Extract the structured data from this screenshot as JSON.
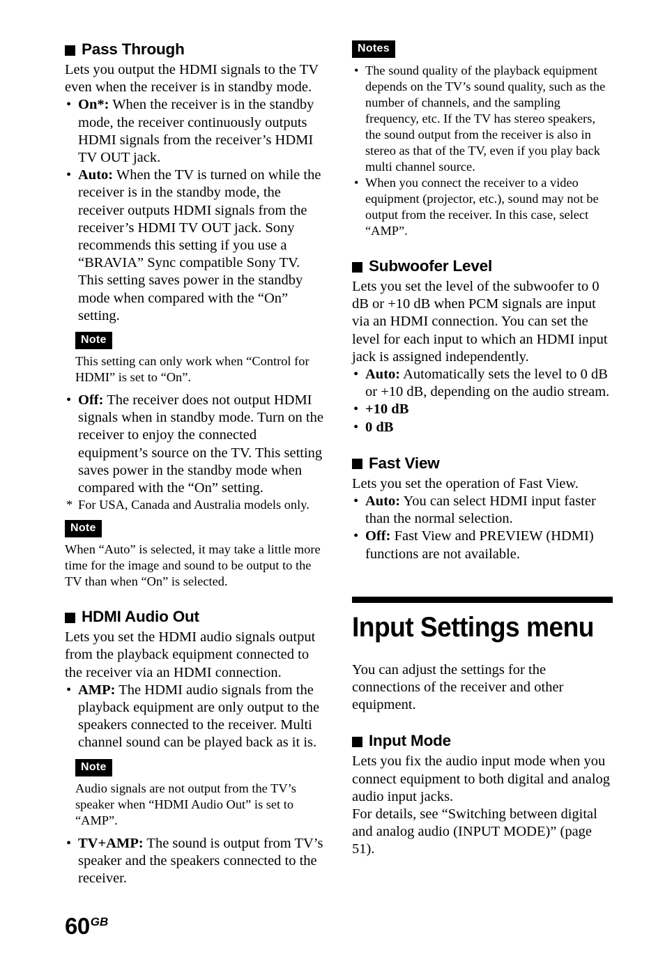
{
  "page": {
    "number": "60",
    "region": "GB"
  },
  "left_column": {
    "pass_through": {
      "heading": "Pass Through",
      "intro": "Lets you output the HDMI signals to the TV even when the receiver is in standby mode.",
      "options": [
        {
          "term": "On*:",
          "desc": " When the receiver is in the standby mode, the receiver continuously outputs HDMI signals from the receiver’s HDMI TV OUT jack."
        },
        {
          "term": "Auto:",
          "desc": " When the TV is turned on while the receiver is in the standby mode, the receiver outputs HDMI signals from the receiver’s HDMI TV OUT jack. Sony recommends this setting if you use a “BRAVIA” Sync compatible Sony TV. This setting saves power in the standby mode when compared with the “On” setting."
        }
      ],
      "note_after_auto": {
        "badge": "Note",
        "text": "This setting can only work when “Control for HDMI” is set to “On”."
      },
      "option_off": {
        "term": "Off:",
        "desc": " The receiver does not output HDMI signals when in standby mode. Turn on the receiver to enjoy the connected equipment’s source on the TV. This setting saves power in the standby mode when compared with the “On” setting."
      },
      "footnote": "For USA, Canada and Australia models only.",
      "note_final": {
        "badge": "Note",
        "text": "When “Auto” is selected, it may take a little more time for the image and sound to be output to the TV than when “On” is selected."
      }
    },
    "hdmi_audio_out": {
      "heading": "HDMI Audio Out",
      "intro": "Lets you set the HDMI audio signals output from the playback equipment connected to the receiver via an HDMI connection.",
      "option_amp": {
        "term": "AMP:",
        "desc": " The HDMI audio signals from the playback equipment are only output to the speakers connected to the receiver. Multi channel sound can be played back as it is."
      },
      "note": {
        "badge": "Note",
        "text": "Audio signals are not output from the TV’s speaker when “HDMI Audio Out” is set to “AMP”."
      },
      "option_tv_amp": {
        "term": "TV+AMP:",
        "desc": " The sound is output from TV’s speaker and the speakers connected to the receiver."
      }
    }
  },
  "right_column": {
    "notes_top": {
      "badge": "Notes",
      "items": [
        "The sound quality of the playback equipment depends on the TV’s sound quality, such as the number of channels, and the sampling frequency, etc. If the TV has stereo speakers, the sound output from the receiver is also in stereo as that of the TV, even if you play back multi channel source.",
        "When you connect the receiver to a video equipment (projector, etc.), sound may not be output from the receiver. In this case, select “AMP”."
      ]
    },
    "subwoofer_level": {
      "heading": "Subwoofer Level",
      "intro": "Lets you set the level of the subwoofer to 0 dB or +10 dB when PCM signals are input via an HDMI connection. You can set the level for each input to which an HDMI input jack is assigned independently.",
      "options": [
        {
          "term": "Auto:",
          "desc": " Automatically sets the level to 0 dB or +10 dB, depending on the audio stream."
        },
        {
          "term": "+10 dB",
          "desc": ""
        },
        {
          "term": "0 dB",
          "desc": ""
        }
      ]
    },
    "fast_view": {
      "heading": "Fast View",
      "intro": "Lets you set the operation of Fast View.",
      "options": [
        {
          "term": "Auto:",
          "desc": " You can select HDMI input faster than the normal selection."
        },
        {
          "term": "Off:",
          "desc": " Fast View and PREVIEW (HDMI) functions are not available."
        }
      ]
    },
    "input_settings_menu": {
      "title": "Input Settings menu",
      "intro": "You can adjust the settings for the connections of the receiver and other equipment.",
      "input_mode": {
        "heading": "Input Mode",
        "paragraph1": "Lets you fix the audio input mode when you connect equipment to both digital and analog audio input jacks.",
        "paragraph2": "For details, see “Switching between digital and analog audio (INPUT MODE)” (page 51)."
      }
    }
  }
}
